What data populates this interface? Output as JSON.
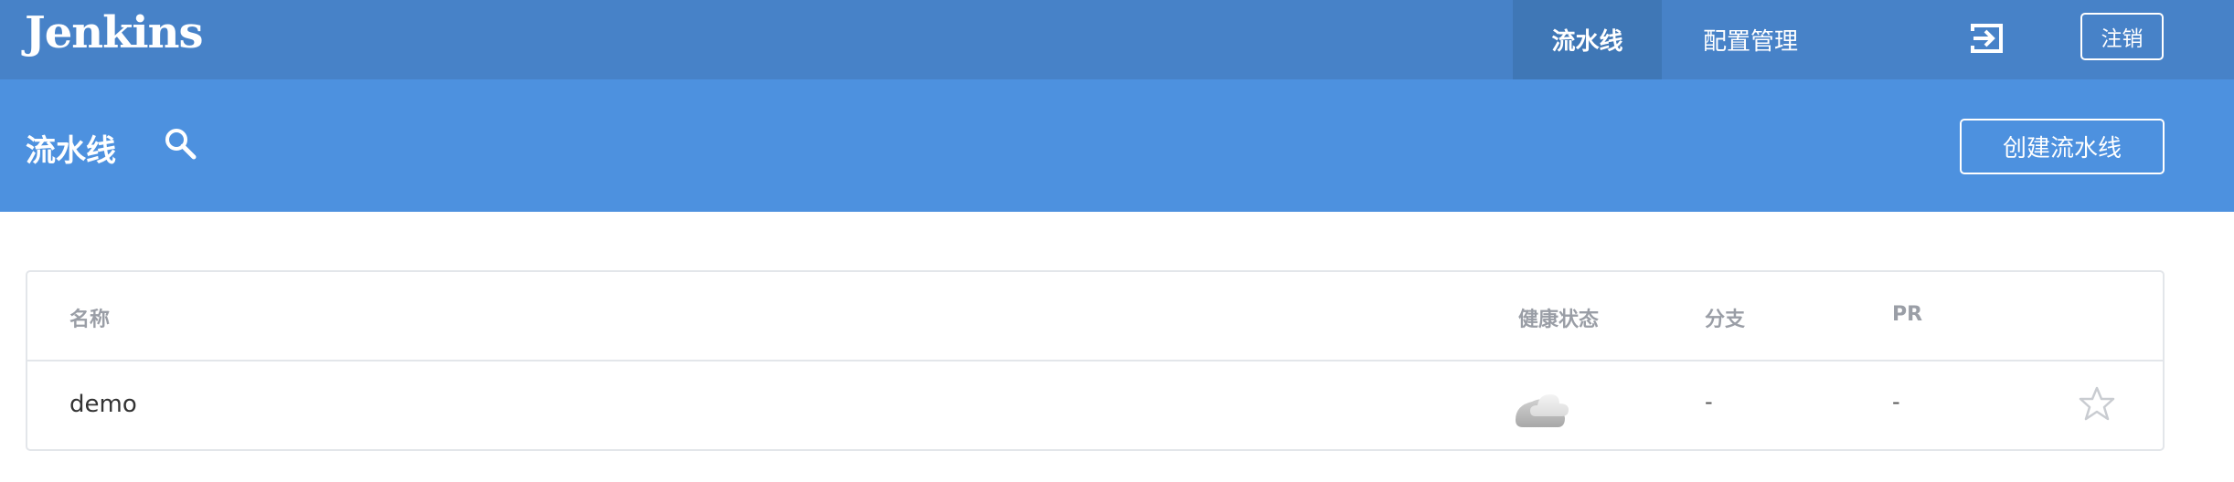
{
  "header": {
    "logo": "Jenkins",
    "nav": [
      {
        "label": "流水线",
        "active": true
      },
      {
        "label": "配置管理",
        "active": false
      }
    ],
    "logout_icon": "sign-in-arrow-icon",
    "signout_label": "注销"
  },
  "subheader": {
    "title": "流水线",
    "search_icon": "search-icon",
    "create_label": "创建流水线"
  },
  "table": {
    "columns": [
      "名称",
      "健康状态",
      "分支",
      "PR"
    ],
    "rows": [
      {
        "name": "demo",
        "health_icon": "cloudy-weather-icon",
        "branches": "-",
        "prs": "-",
        "favorite": false
      }
    ]
  },
  "colors": {
    "topbar": "#4782c8",
    "band": "#4d91df",
    "active_tab": "#3f77b6"
  }
}
